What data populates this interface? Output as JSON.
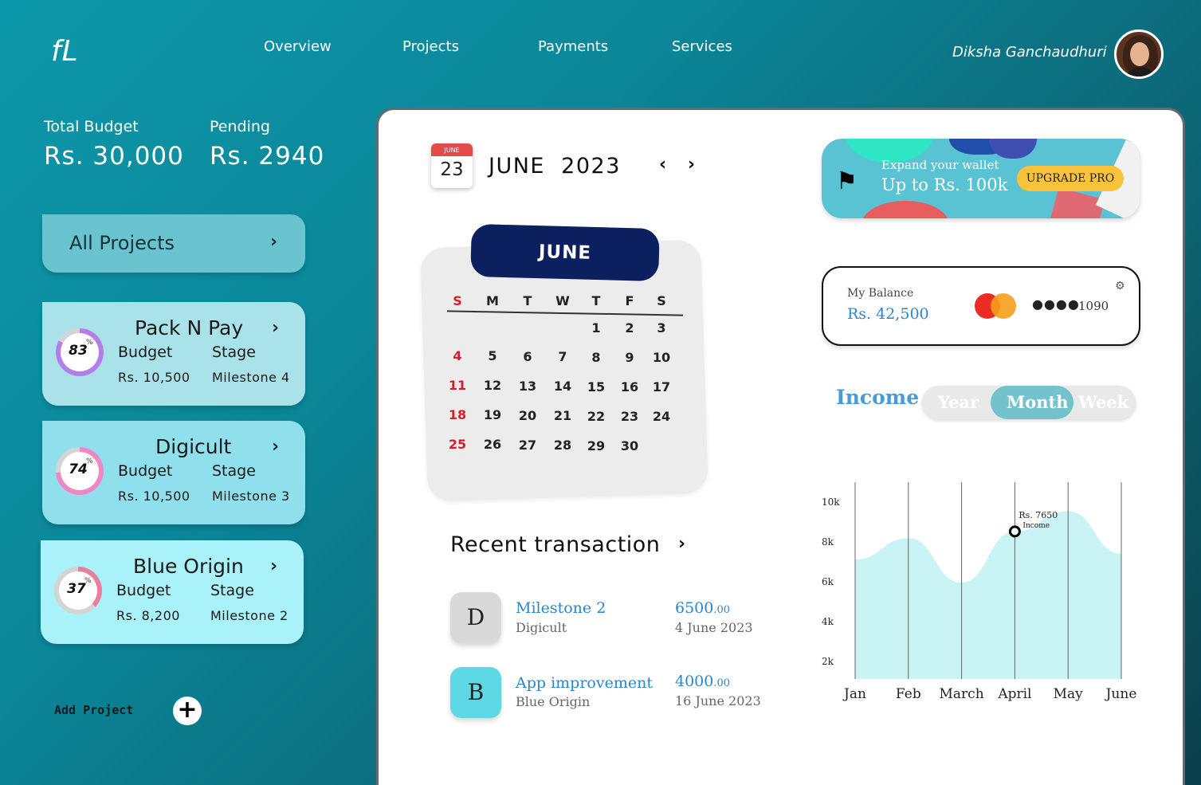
{
  "brand": {
    "logo": "fL"
  },
  "nav": [
    "Overview",
    "Projects",
    "Payments",
    "Services"
  ],
  "user": {
    "name": "Diksha Ganchaudhuri"
  },
  "stats": {
    "total_budget_label": "Total Budget",
    "total_budget_value": "Rs. 30,000",
    "pending_label": "Pending",
    "pending_value": "Rs. 2940"
  },
  "all_projects": {
    "label": "All Projects"
  },
  "projects": [
    {
      "name": "Pack N Pay",
      "percent": "83",
      "percent_sign": "%",
      "budget_label": "Budget",
      "budget": "Rs. 10,500",
      "stage_label": "Stage",
      "stage": "Milestone 4",
      "progress": 0.83,
      "bg": "#a9e3e9",
      "ring": "#b47ee8"
    },
    {
      "name": "Digicult",
      "percent": "74",
      "percent_sign": "%",
      "budget_label": "Budget",
      "budget": "Rs. 10,500",
      "stage_label": "Stage",
      "stage": "Milestone 3",
      "progress": 0.74,
      "bg": "#8fe0ec",
      "ring": "#ef87c4"
    },
    {
      "name": "Blue Origin",
      "percent": "37",
      "percent_sign": "%",
      "budget_label": "Budget",
      "budget": "Rs. 8,200",
      "stage_label": "Stage",
      "stage": "Milestone 2",
      "progress": 0.37,
      "bg": "#a9f2f9",
      "ring": "#e8809c"
    }
  ],
  "add_project": {
    "label": "Add Project",
    "icon": "plus-circle-icon"
  },
  "calendar": {
    "icon_month": "JUNE",
    "icon_day": "23",
    "month": "JUNE",
    "year": "2023",
    "header": "JUNE",
    "weekdays": [
      "S",
      "M",
      "T",
      "W",
      "T",
      "F",
      "S"
    ],
    "weeks": [
      [
        "",
        "",
        "",
        "",
        "1",
        "2",
        "3"
      ],
      [
        "4",
        "5",
        "6",
        "7",
        "8",
        "9",
        "10"
      ],
      [
        "11",
        "12",
        "13",
        "14",
        "15",
        "16",
        "17"
      ],
      [
        "18",
        "19",
        "20",
        "21",
        "22",
        "23",
        "24"
      ],
      [
        "25",
        "26",
        "27",
        "28",
        "29",
        "30",
        ""
      ]
    ]
  },
  "recent": {
    "title": "Recent transaction",
    "items": [
      {
        "initial": "D",
        "title": "Milestone 2",
        "sub": "Digicult",
        "amount_main": "6500",
        "amount_dec": ".00",
        "date": "4 June 2023",
        "color": "#d9d9d9"
      },
      {
        "initial": "B",
        "title": "App improvement",
        "sub": "Blue Origin",
        "amount_main": "4000",
        "amount_dec": ".00",
        "date": "16 June 2023",
        "color": "#5fd8e6"
      }
    ]
  },
  "promo": {
    "line1": "Expand your wallet",
    "line2": "Up to Rs. 100k",
    "button": "UPGRADE PRO",
    "icon": "flag-icon"
  },
  "balance": {
    "label": "My Balance",
    "value": "Rs. 42,500",
    "card_dots": "●●●●",
    "card_last4": "1090",
    "card_brand": "mastercard-icon"
  },
  "income": {
    "title": "Income",
    "tabs": [
      "Year",
      "Month",
      "Week"
    ],
    "active_tab": "Month"
  },
  "chart_data": {
    "type": "area",
    "categories": [
      "Jan",
      "Feb",
      "March",
      "April",
      "May",
      "June"
    ],
    "values": [
      6200,
      7300,
      5000,
      7650,
      8700,
      6500
    ],
    "yticks": [
      "10k",
      "8k",
      "6k",
      "4k",
      "2k"
    ],
    "ylim": [
      0,
      10000
    ],
    "annotation": {
      "category": "April",
      "value": "Rs. 7650",
      "label": "Income"
    },
    "fill": "#c6f2f4",
    "grid": "vertical"
  }
}
